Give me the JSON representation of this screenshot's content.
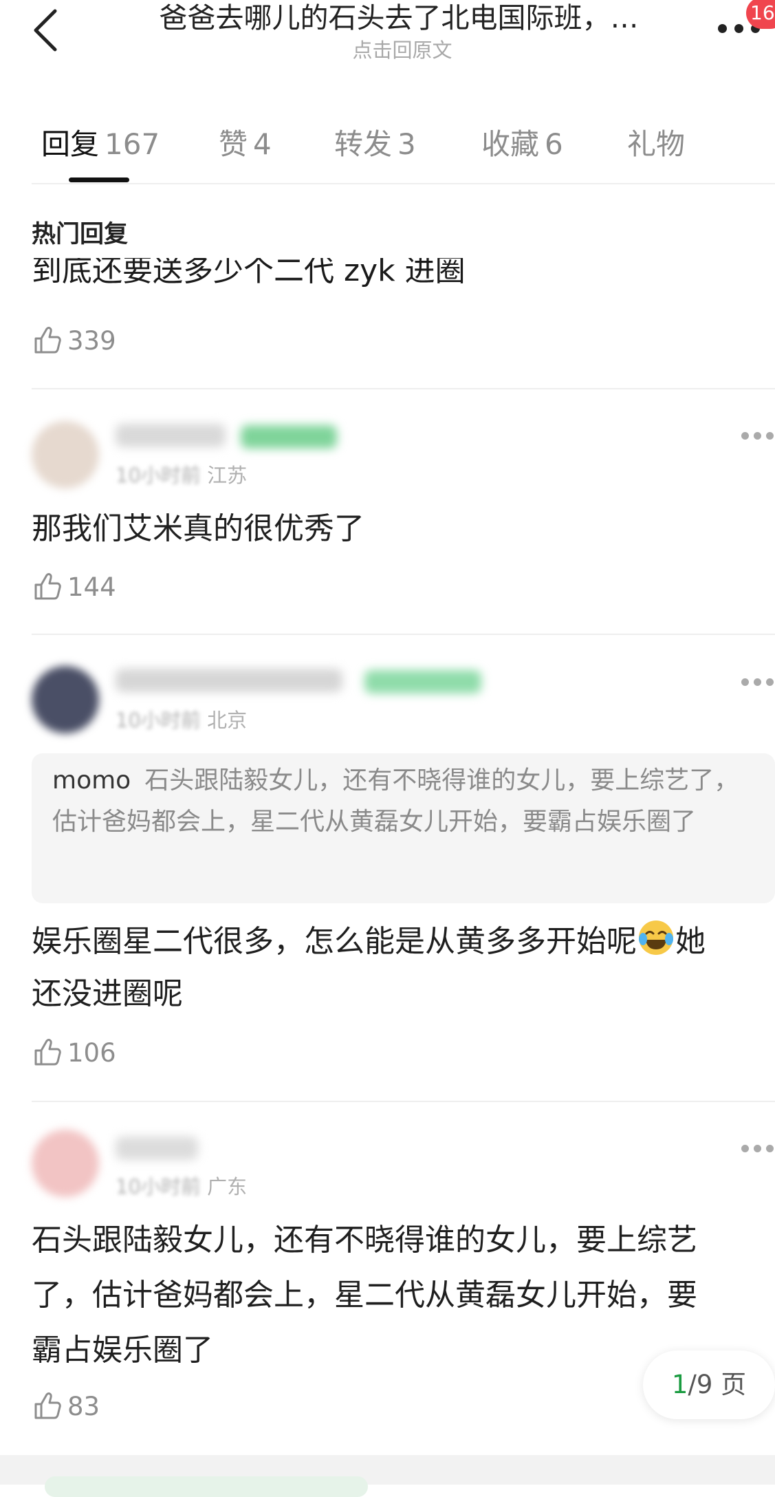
{
  "header": {
    "title": "爸爸去哪儿的石头去了北电国际班，…",
    "subtitle": "点击回原文",
    "badge": "16"
  },
  "tabs": [
    {
      "label": "回复",
      "count": "167",
      "active": true
    },
    {
      "label": "赞",
      "count": "4"
    },
    {
      "label": "转发",
      "count": "3"
    },
    {
      "label": "收藏",
      "count": "6"
    },
    {
      "label": "礼物",
      "count": ""
    }
  ],
  "section_title": "热门回复",
  "comments": [
    {
      "text": "到底还要送多少个二代 zyk 进圈",
      "likes": "339"
    },
    {
      "meta_time": "10小时前",
      "meta_location": "江苏",
      "text": "那我们艾米真的很优秀了",
      "likes": "144"
    },
    {
      "meta_time": "10小时前",
      "meta_location": "北京",
      "quote_author": "momo",
      "quote_text": "石头跟陆毅女儿，还有不晓得谁的女儿，要上综艺了，估计爸妈都会上，星二代从黄磊女儿开始，要霸占娱乐圈了",
      "text_line1": "娱乐圈星二代很多，怎么能是从黄多多开始呢",
      "text_line1_tail": "她",
      "text_line2": "还没进圈呢",
      "emoji": "laughing-crying",
      "likes": "106"
    },
    {
      "meta_time": "10小时前",
      "meta_location": "广东",
      "text_line1": "石头跟陆毅女儿，还有不晓得谁的女儿，要上综艺",
      "text_line2": "了，估计爸妈都会上，星二代从黄磊女儿开始，要",
      "text_line3": "霸占娱乐圈了",
      "likes": "83"
    }
  ],
  "pager": {
    "current": "1",
    "total_text": "/9 页"
  },
  "colors": {
    "accent_green": "#1a9b40",
    "badge_red": "#f0454e"
  }
}
